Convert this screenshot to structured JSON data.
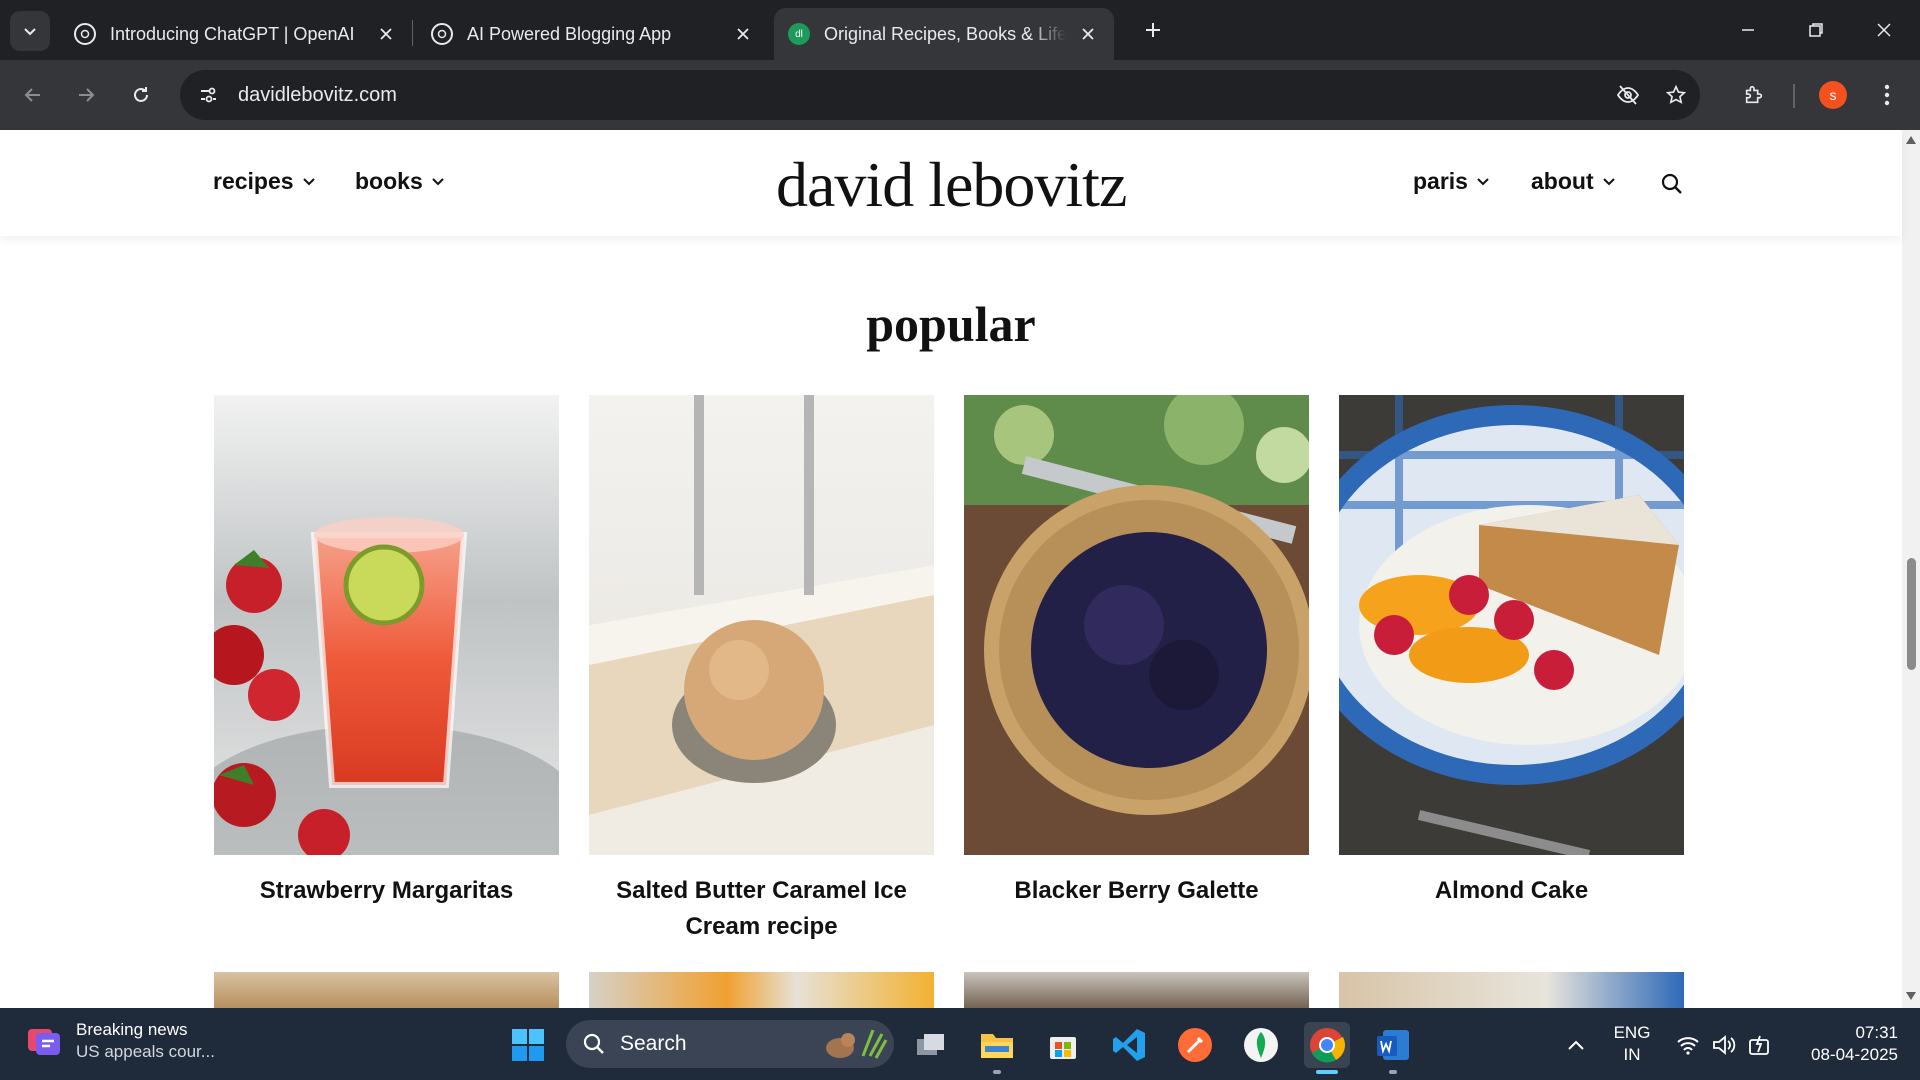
{
  "browser": {
    "tabs": [
      {
        "title": "Introducing ChatGPT | OpenAI",
        "active": false
      },
      {
        "title": "AI Powered Blogging App",
        "active": false
      },
      {
        "title": "Original Recipes, Books & Life in Paris",
        "active": true,
        "favicon_text": "dl"
      }
    ],
    "url": "davidlebovitz.com",
    "profile_initial": "s",
    "colors": {
      "accent": "#35363a",
      "favicon_green": "#1e9b5a",
      "profile": "#f4511e"
    }
  },
  "site": {
    "logo": "david lebovitz",
    "nav_left": [
      "recipes",
      "books"
    ],
    "nav_right": [
      "paris",
      "about"
    ],
    "section_title": "popular",
    "cards": [
      {
        "caption": "Strawberry Margaritas"
      },
      {
        "caption": "Salted Butter Caramel Ice Cream recipe"
      },
      {
        "caption": "Blacker Berry Galette"
      },
      {
        "caption": "Almond Cake"
      }
    ]
  },
  "taskbar": {
    "news_title": "Breaking news",
    "news_subtitle": "US appeals cour...",
    "search_label": "Search",
    "language_line1": "ENG",
    "language_line2": "IN",
    "time": "07:31",
    "date": "08-04-2025"
  }
}
